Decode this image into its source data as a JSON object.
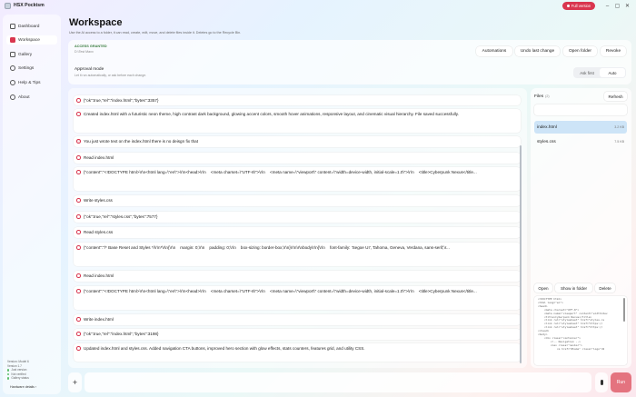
{
  "app": {
    "title": "HSX Pocktsm",
    "full_version": "Full version",
    "window_controls": [
      "–",
      "▢",
      "✕"
    ]
  },
  "sidebar": {
    "items": [
      {
        "label": "Dashboard",
        "icon": "dashboard-icon"
      },
      {
        "label": "Workspace",
        "icon": "workspace-icon",
        "active": true
      },
      {
        "label": "Gallery",
        "icon": "gallery-icon"
      },
      {
        "label": "Settings",
        "icon": "gear-icon"
      },
      {
        "label": "Help & Tips",
        "icon": "help-icon"
      },
      {
        "label": "About",
        "icon": "info-icon"
      }
    ],
    "footer": {
      "line1": "Version: Model 6",
      "line2": "Version 1.7",
      "status": [
        "Just version",
        "Not verified",
        "Gallery status"
      ],
      "hardware_link": "Hardware details ›"
    }
  },
  "header": {
    "title": "Workspace",
    "description": "Use the AI access to a folder, it can read, create, edit, move, and delete files inside it. Deletes go to the Recycle Bin."
  },
  "access": {
    "label": "ACCESS GRANTED",
    "sub": "D:\\Test Maxx",
    "buttons": [
      "Automations",
      "Undo last change",
      "Open folder",
      "Revoke"
    ]
  },
  "approval": {
    "label": "Approval mode",
    "sub": "Let it run automatically, or ask before each change.",
    "options": [
      "Ask first",
      "Auto"
    ],
    "selected": "Auto"
  },
  "messages": [
    {
      "kind": "tool",
      "text": "{\"ok\":true,\"rel\":\"index.html\",\"bytes\":3357}"
    },
    {
      "kind": "assistant",
      "text": "Created index.html with a futuristic neon theme, high contrast dark background, glowing accent colors, smooth hover animations, responsive layout, and cinematic visual hierarchy. File saved successfully."
    },
    {
      "kind": "user",
      "text": "You just wrote text on the index.html there is no deisgn fix that"
    },
    {
      "kind": "tool",
      "text": "Read index.html"
    },
    {
      "kind": "tool",
      "text": "{\"content\":\"<!DOCTYPE html>\\r\\n<html lang=\\\"en\\\">\\r\\n<head>\\r\\n    <meta charset=\\\"UTF-8\\\">\\r\\n    <meta name=\\\"viewport\\\" content=\\\"width=device-width, initial-scale=1.0\\\">\\r\\n    <title>Cyberpunk Nexus</title..."
    },
    {
      "kind": "tool",
      "text": "Write styles.css"
    },
    {
      "kind": "tool",
      "text": "{\"ok\":true,\"rel\":\"styles.css\",\"bytes\":7577}"
    },
    {
      "kind": "tool",
      "text": "Read styles.css"
    },
    {
      "kind": "tool",
      "text": "{\"content\":\"/* Base Reset and Styles */\\r\\n*\\r\\n{\\r\\n    margin: 0;\\r\\n    padding: 0;\\r\\n    box-sizing: border-box;\\r\\n}\\r\\n\\r\\nbody\\r\\n{\\r\\n    font-family: 'Segoe UI', Tahoma, Geneva, Verdana, sans-serif;\\r..."
    },
    {
      "kind": "tool",
      "text": "Read index.html"
    },
    {
      "kind": "tool",
      "text": "{\"content\":\"<!DOCTYPE html>\\r\\n<html lang=\\\"en\\\">\\r\\n<head>\\r\\n    <meta charset=\\\"UTF-8\\\">\\r\\n    <meta name=\\\"viewport\\\" content=\\\"width=device-width, initial-scale=1.0\\\">\\r\\n    <title>Cyberpunk Nexus</title..."
    },
    {
      "kind": "tool",
      "text": "Write index.html"
    },
    {
      "kind": "tool",
      "text": "{\"ok\":true,\"rel\":\"index.html\",\"bytes\":3198}"
    },
    {
      "kind": "assistant",
      "text": "Updated index.html and styles.css. Added navigation CTA buttons, improved hero section with glow effects, stats counters, features grid, and utility CSS."
    }
  ],
  "files": {
    "title": "Files",
    "count": "(2)",
    "refresh": "Refresh",
    "items": [
      {
        "name": "index.html",
        "size": "3.2 KB",
        "selected": true
      },
      {
        "name": "styles.css",
        "size": "7.5 KB",
        "selected": false
      }
    ],
    "actions": [
      "Open",
      "Show in folder",
      "Delete"
    ],
    "preview": "<!DOCTYPE html>\n<html lang=\"en\">\n<head>\n    <meta charset=\"UTF-8\">\n    <meta name=\"viewport\" content=\"width=dev\n    <title>Cyberpunk Nexus</title>\n    <link rel=\"stylesheet\" href=\"styles.cs\n    <link rel=\"stylesheet\" href=\"https://\n    <link rel=\"stylesheet\" href=\"https://\n</head>\n<body>\n    <div class=\"container\">\n        <!-- Navigation -->\n        <nav class=\"navbar\">\n            <a href=\"#home\" class=\"logo\">N"
  },
  "composer": {
    "plus": "+",
    "placeholder": "",
    "run": "Run"
  },
  "colors": {
    "accent": "#d9364f",
    "run": "#e4737f",
    "selected_file": "#cde4f7"
  }
}
